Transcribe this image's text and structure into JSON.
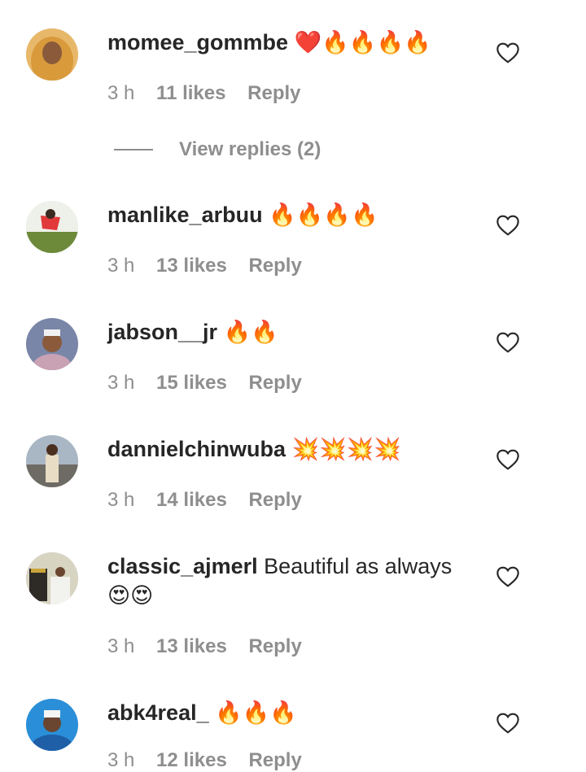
{
  "comments": [
    {
      "username": "momee_gommbe",
      "text": "❤️🔥🔥🔥🔥",
      "time": "3 h",
      "likes": "11 likes",
      "reply": "Reply"
    },
    {
      "username": "manlike_arbuu",
      "text": " 🔥🔥🔥🔥",
      "time": "3 h",
      "likes": "13 likes",
      "reply": "Reply"
    },
    {
      "username": "jabson__jr",
      "text": " 🔥🔥",
      "time": "3 h",
      "likes": "15 likes",
      "reply": "Reply"
    },
    {
      "username": "dannielchinwuba",
      "text": " 💥💥💥💥",
      "time": "3 h",
      "likes": "14 likes",
      "reply": "Reply"
    },
    {
      "username": "classic_ajmerl",
      "text": " Beautiful as always 😍😍",
      "time": "3 h",
      "likes": "13 likes",
      "reply": "Reply"
    },
    {
      "username": "abk4real_",
      "text": " 🔥🔥🔥",
      "time": "3 h",
      "likes": "12 likes",
      "reply": "Reply"
    }
  ],
  "view_replies": "View replies (2)",
  "icons": {
    "like": "heart-outline-icon"
  },
  "colors": {
    "text": "#262626",
    "muted": "#8e8e8e",
    "background": "#ffffff"
  }
}
